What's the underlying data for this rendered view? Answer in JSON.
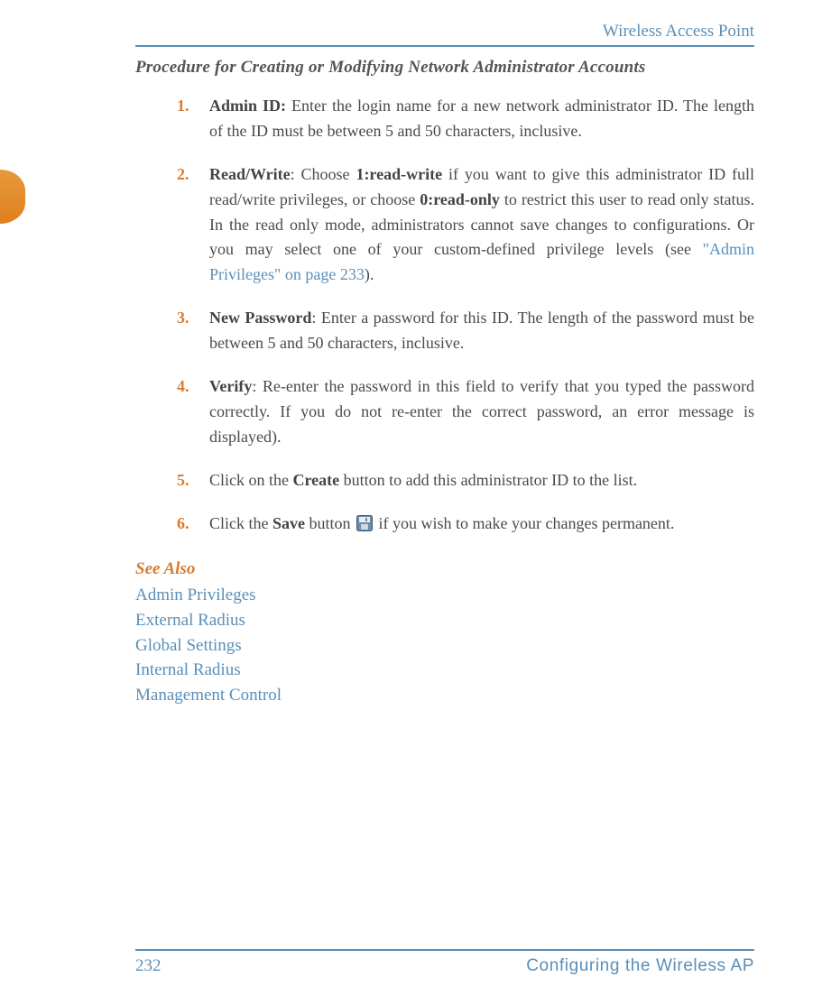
{
  "running_header": "Wireless Access Point",
  "section_title": "Procedure for Creating or Modifying Network Administrator Accounts",
  "steps": [
    {
      "num": "1.",
      "label": "Admin ID:",
      "text_after_label": " Enter the login name for a new network administrator ID. The length of the ID must be between 5 and 50 characters, inclusive."
    },
    {
      "num": "2.",
      "label": "Read/Write",
      "colon": ": Choose ",
      "bold1": "1:read-write",
      "mid1": " if you want to give this administrator ID full read/write privileges, or choose ",
      "bold2": "0:read-only",
      "mid2": " to restrict this user to read only status. In the read only mode, administrators cannot save changes to configurations. Or you may select one of your custom-defined privilege levels (see ",
      "link": "\"Admin Privileges\" on page 233",
      "end": ")."
    },
    {
      "num": "3.",
      "label": "New Password",
      "text_after_label": ": Enter a password for this ID. The length of the password must be between 5 and 50 characters, inclusive."
    },
    {
      "num": "4.",
      "label": "Verify",
      "text_after_label": ": Re-enter the password in this field to verify that you typed the password correctly. If you do not re-enter the correct password, an error message is displayed)."
    },
    {
      "num": "5.",
      "pre": "Click on the ",
      "bold": "Create",
      "post": " button to add this administrator ID to the list."
    },
    {
      "num": "6.",
      "pre": "Click the ",
      "bold": "Save",
      "middle": " button ",
      "post_icon": " if you wish to make your changes permanent."
    }
  ],
  "see_also_heading": "See Also",
  "see_also_links": [
    "Admin Privileges",
    "External Radius",
    "Global Settings",
    "Internal Radius",
    "Management Control"
  ],
  "footer": {
    "page_number": "232",
    "section": "Configuring the Wireless AP"
  }
}
